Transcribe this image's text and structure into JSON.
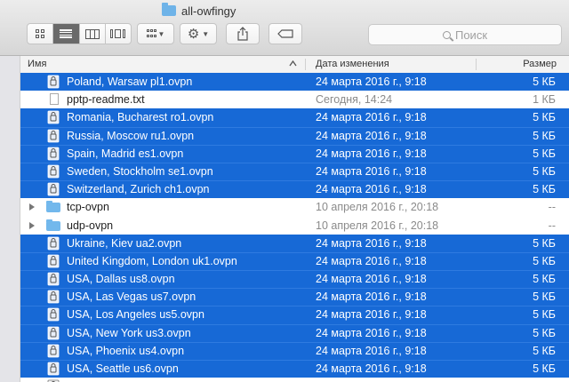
{
  "window": {
    "title": "all-owfingy"
  },
  "toolbar": {
    "view_icons": [
      "icon-view-icon",
      "list-view-icon",
      "column-view-icon",
      "coverflow-view-icon"
    ],
    "active_view": "list"
  },
  "search": {
    "placeholder": "Поиск"
  },
  "columns": {
    "name": "Имя",
    "date": "Дата изменения",
    "size": "Размер"
  },
  "colors": {
    "selection": "#1769d6",
    "folder": "#72b8ec"
  },
  "rows": [
    {
      "name": "Poland, Warsaw pl1.ovpn",
      "date": "24 марта 2016 г., 9:18",
      "size": "5 КБ",
      "kind": "ovpn",
      "selected": true
    },
    {
      "name": "pptp-readme.txt",
      "date": "Сегодня, 14:24",
      "size": "1 КБ",
      "kind": "txt",
      "selected": false
    },
    {
      "name": "Romania, Bucharest ro1.ovpn",
      "date": "24 марта 2016 г., 9:18",
      "size": "5 КБ",
      "kind": "ovpn",
      "selected": true
    },
    {
      "name": "Russia, Moscow ru1.ovpn",
      "date": "24 марта 2016 г., 9:18",
      "size": "5 КБ",
      "kind": "ovpn",
      "selected": true
    },
    {
      "name": "Spain, Madrid es1.ovpn",
      "date": "24 марта 2016 г., 9:18",
      "size": "5 КБ",
      "kind": "ovpn",
      "selected": true
    },
    {
      "name": "Sweden, Stockholm se1.ovpn",
      "date": "24 марта 2016 г., 9:18",
      "size": "5 КБ",
      "kind": "ovpn",
      "selected": true
    },
    {
      "name": "Switzerland, Zurich ch1.ovpn",
      "date": "24 марта 2016 г., 9:18",
      "size": "5 КБ",
      "kind": "ovpn",
      "selected": true
    },
    {
      "name": "tcp-ovpn",
      "date": "10 апреля 2016 г., 20:18",
      "size": "--",
      "kind": "folder",
      "selected": false
    },
    {
      "name": "udp-ovpn",
      "date": "10 апреля 2016 г., 20:18",
      "size": "--",
      "kind": "folder",
      "selected": false
    },
    {
      "name": "Ukraine, Kiev ua2.ovpn",
      "date": "24 марта 2016 г., 9:18",
      "size": "5 КБ",
      "kind": "ovpn",
      "selected": true
    },
    {
      "name": "United Kingdom, London uk1.ovpn",
      "date": "24 марта 2016 г., 9:18",
      "size": "5 КБ",
      "kind": "ovpn",
      "selected": true
    },
    {
      "name": "USA, Dallas us8.ovpn",
      "date": "24 марта 2016 г., 9:18",
      "size": "5 КБ",
      "kind": "ovpn",
      "selected": true
    },
    {
      "name": "USA, Las Vegas us7.ovpn",
      "date": "24 марта 2016 г., 9:18",
      "size": "5 КБ",
      "kind": "ovpn",
      "selected": true
    },
    {
      "name": "USA, Los Angeles us5.ovpn",
      "date": "24 марта 2016 г., 9:18",
      "size": "5 КБ",
      "kind": "ovpn",
      "selected": true
    },
    {
      "name": "USA, New York us3.ovpn",
      "date": "24 марта 2016 г., 9:18",
      "size": "5 КБ",
      "kind": "ovpn",
      "selected": true
    },
    {
      "name": "USA, Phoenix us4.ovpn",
      "date": "24 марта 2016 г., 9:18",
      "size": "5 КБ",
      "kind": "ovpn",
      "selected": true
    },
    {
      "name": "USA, Seattle us6.ovpn",
      "date": "24 марта 2016 г., 9:18",
      "size": "5 КБ",
      "kind": "ovpn",
      "selected": true
    },
    {
      "name": "",
      "date": "",
      "size": "",
      "kind": "ovpn",
      "selected": false
    }
  ]
}
